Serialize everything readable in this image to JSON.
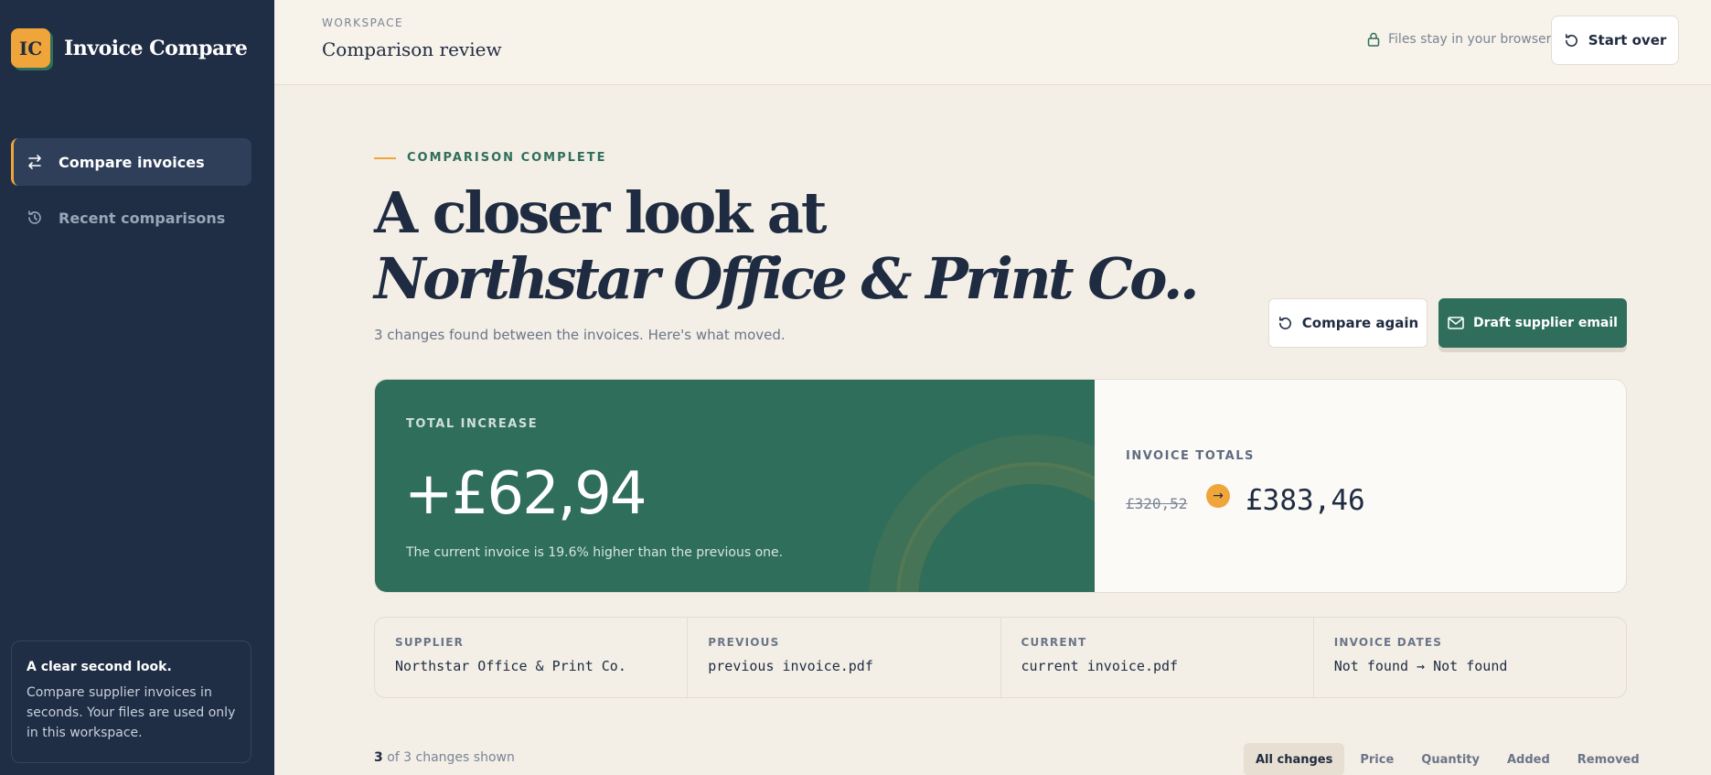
{
  "brand": {
    "logo_text": "IC",
    "name": "Invoice Compare"
  },
  "sidebar": {
    "items": [
      {
        "label": "Compare invoices",
        "icon": "arrows-swap-icon",
        "active": true
      },
      {
        "label": "Recent comparisons",
        "icon": "history-icon",
        "active": false
      }
    ],
    "info": {
      "title": "A clear second look.",
      "text": "Compare supplier invoices in seconds. Your files are used only in this workspace."
    }
  },
  "topbar": {
    "eyebrow": "WORKSPACE",
    "title": "Comparison review",
    "privacy": "Files stay in your browser",
    "start_over": "Start over"
  },
  "hero": {
    "kicker": "COMPARISON COMPLETE",
    "headline_line1": "A closer look at",
    "headline_line2": "Northstar Office & Print Co..",
    "subline": "3 changes found between the invoices. Here's what moved.",
    "compare_again": "Compare again",
    "draft_email": "Draft supplier email"
  },
  "summary": {
    "total_label": "TOTAL INCREASE",
    "total_value": "+£62,94",
    "total_note": "The current invoice is 19.6% higher than the previous one.",
    "totals_label": "INVOICE TOTALS",
    "previous_total": "£320,52",
    "current_total": "£383,46"
  },
  "meta": {
    "supplier": {
      "label": "SUPPLIER",
      "value": "Northstar Office & Print Co."
    },
    "previous": {
      "label": "PREVIOUS",
      "value": "previous invoice.pdf"
    },
    "current": {
      "label": "CURRENT",
      "value": "current invoice.pdf"
    },
    "dates": {
      "label": "INVOICE DATES",
      "value": "Not found → Not found"
    }
  },
  "changes": {
    "shown": "3",
    "suffix": "of 3 changes shown",
    "filters": [
      "All changes",
      "Price",
      "Quantity",
      "Added",
      "Removed"
    ],
    "active_filter": "All changes"
  },
  "colors": {
    "sidebar_bg": "#1f2d45",
    "accent": "#f0a53a",
    "brand_green": "#2f6e5b",
    "page_bg": "#f3efe7"
  }
}
